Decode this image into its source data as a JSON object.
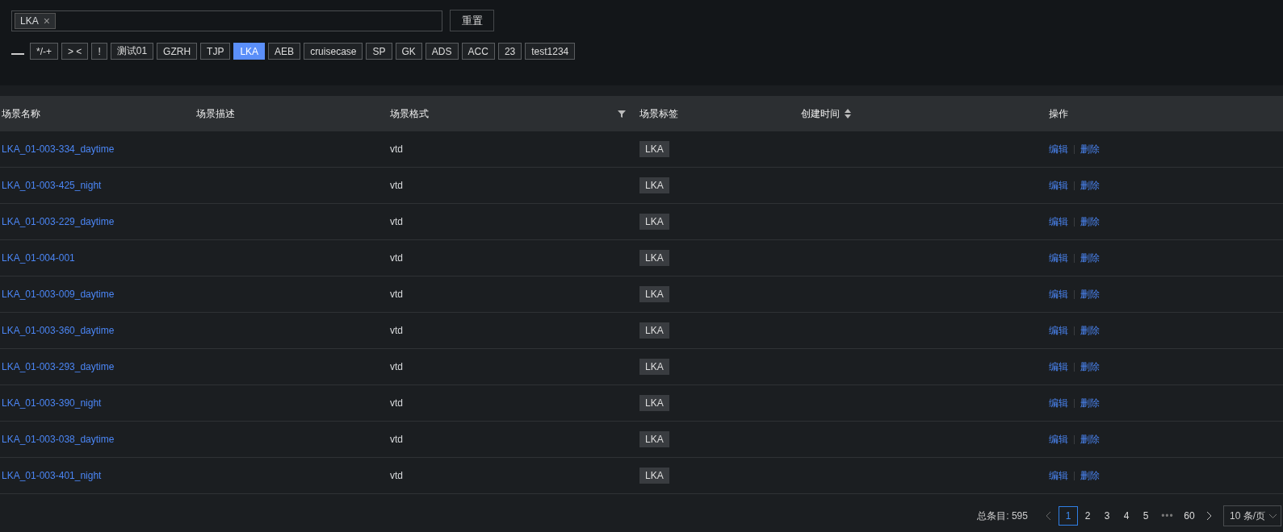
{
  "search": {
    "chips": [
      {
        "label": "LKA",
        "remove": "×"
      }
    ]
  },
  "reset_button": "重置",
  "tag_filters": [
    {
      "label": "*/-+",
      "selected": false
    },
    {
      "label": "> <",
      "selected": false
    },
    {
      "label": "!",
      "selected": false
    },
    {
      "label": "测试01",
      "selected": false
    },
    {
      "label": "GZRH",
      "selected": false
    },
    {
      "label": "TJP",
      "selected": false
    },
    {
      "label": "LKA",
      "selected": true
    },
    {
      "label": "AEB",
      "selected": false
    },
    {
      "label": "cruisecase",
      "selected": false
    },
    {
      "label": "SP",
      "selected": false
    },
    {
      "label": "GK",
      "selected": false
    },
    {
      "label": "ADS",
      "selected": false
    },
    {
      "label": "ACC",
      "selected": false
    },
    {
      "label": "23",
      "selected": false
    },
    {
      "label": "test1234",
      "selected": false
    }
  ],
  "table": {
    "columns": [
      {
        "label": "场景名称",
        "kind": "plain"
      },
      {
        "label": "场景描述",
        "kind": "plain"
      },
      {
        "label": "场景格式",
        "kind": "filter"
      },
      {
        "label": "场景标签",
        "kind": "plain"
      },
      {
        "label": "创建时间",
        "kind": "sort"
      },
      {
        "label": "操作",
        "kind": "plain"
      }
    ],
    "rows": [
      {
        "name": "LKA_01-003-334_daytime",
        "format": "vtd",
        "tag": "LKA",
        "actions": [
          "编辑",
          "删除"
        ]
      },
      {
        "name": "LKA_01-003-425_night",
        "format": "vtd",
        "tag": "LKA",
        "actions": [
          "编辑",
          "删除"
        ]
      },
      {
        "name": "LKA_01-003-229_daytime",
        "format": "vtd",
        "tag": "LKA",
        "actions": [
          "编辑",
          "删除"
        ]
      },
      {
        "name": "LKA_01-004-001",
        "format": "vtd",
        "tag": "LKA",
        "actions": [
          "编辑",
          "删除"
        ]
      },
      {
        "name": "LKA_01-003-009_daytime",
        "format": "vtd",
        "tag": "LKA",
        "actions": [
          "编辑",
          "删除"
        ]
      },
      {
        "name": "LKA_01-003-360_daytime",
        "format": "vtd",
        "tag": "LKA",
        "actions": [
          "编辑",
          "删除"
        ]
      },
      {
        "name": "LKA_01-003-293_daytime",
        "format": "vtd",
        "tag": "LKA",
        "actions": [
          "编辑",
          "删除"
        ]
      },
      {
        "name": "LKA_01-003-390_night",
        "format": "vtd",
        "tag": "LKA",
        "actions": [
          "编辑",
          "删除"
        ]
      },
      {
        "name": "LKA_01-003-038_daytime",
        "format": "vtd",
        "tag": "LKA",
        "actions": [
          "编辑",
          "删除"
        ]
      },
      {
        "name": "LKA_01-003-401_night",
        "format": "vtd",
        "tag": "LKA",
        "actions": [
          "编辑",
          "删除"
        ]
      }
    ]
  },
  "pagination": {
    "total": "总条目: 595",
    "pages": [
      {
        "label": "1",
        "selected": true
      },
      {
        "label": "2",
        "selected": false
      },
      {
        "label": "3",
        "selected": false
      },
      {
        "label": "4",
        "selected": false
      },
      {
        "label": "5",
        "selected": false
      },
      {
        "label": "•••",
        "kind": "ellipsis"
      },
      {
        "label": "60",
        "selected": false
      }
    ],
    "page_size": "10 条/页"
  }
}
